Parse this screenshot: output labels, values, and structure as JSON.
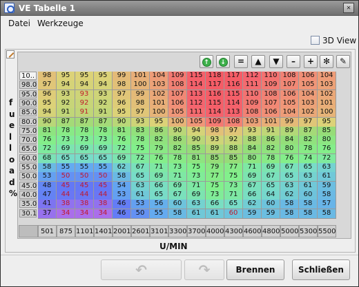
{
  "window": {
    "title": "VE Tabelle 1"
  },
  "menu": {
    "file": "Datei",
    "tools": "Werkzeuge"
  },
  "view_toggle": {
    "label": "3D View",
    "checked": false
  },
  "toolbar": {
    "eq": "=",
    "up": "▲",
    "down": "▼",
    "minus": "–",
    "plus": "+",
    "mult": "✻",
    "up_round": "↑",
    "down_round": "↓"
  },
  "y_axis_label": "fuel load %",
  "x_axis_label": "U/MIN",
  "rows": [
    "10..",
    "98.0",
    "95.0",
    "90.0",
    "85.0",
    "80.0",
    "75.0",
    "70.0",
    "65.0",
    "60.0",
    "55.0",
    "50.0",
    "45.0",
    "40.0",
    "35.0",
    "30.1"
  ],
  "cols": [
    "501",
    "875",
    "1101",
    "1401",
    "2001",
    "2601",
    "3101",
    "3300",
    "3700",
    "4000",
    "4300",
    "4600",
    "4800",
    "5000",
    "5300",
    "5500"
  ],
  "table": [
    [
      "98",
      "95",
      "95",
      "95",
      "99",
      "101",
      "104",
      "109",
      "115",
      "118",
      "117",
      "112",
      "110",
      "108",
      "106",
      "104"
    ],
    [
      "97",
      "94",
      "94",
      "94",
      "98",
      "100",
      "103",
      "108",
      "114",
      "117",
      "116",
      "111",
      "109",
      "107",
      "105",
      "103"
    ],
    [
      "96",
      "93",
      "93",
      "93",
      "97",
      "99",
      "102",
      "107",
      "113",
      "116",
      "115",
      "110",
      "108",
      "106",
      "104",
      "102"
    ],
    [
      "95",
      "92",
      "92",
      "92",
      "96",
      "98",
      "101",
      "106",
      "112",
      "115",
      "114",
      "109",
      "107",
      "105",
      "103",
      "101"
    ],
    [
      "94",
      "91",
      "91",
      "91",
      "95",
      "97",
      "100",
      "105",
      "111",
      "114",
      "113",
      "108",
      "106",
      "104",
      "102",
      "100"
    ],
    [
      "90",
      "87",
      "87",
      "87",
      "90",
      "93",
      "95",
      "100",
      "105",
      "109",
      "108",
      "103",
      "101",
      "99",
      "97",
      "95"
    ],
    [
      "81",
      "78",
      "78",
      "78",
      "81",
      "83",
      "86",
      "90",
      "94",
      "98",
      "97",
      "93",
      "91",
      "89",
      "87",
      "85"
    ],
    [
      "76",
      "73",
      "73",
      "73",
      "76",
      "78",
      "82",
      "86",
      "90",
      "93",
      "92",
      "88",
      "86",
      "84",
      "82",
      "80"
    ],
    [
      "72",
      "69",
      "69",
      "69",
      "72",
      "75",
      "79",
      "82",
      "85",
      "89",
      "88",
      "84",
      "82",
      "80",
      "78",
      "76"
    ],
    [
      "68",
      "65",
      "65",
      "65",
      "69",
      "72",
      "76",
      "78",
      "81",
      "85",
      "85",
      "80",
      "78",
      "76",
      "74",
      "72"
    ],
    [
      "58",
      "55",
      "55",
      "55",
      "62",
      "67",
      "71",
      "73",
      "75",
      "79",
      "77",
      "71",
      "69",
      "67",
      "65",
      "63"
    ],
    [
      "53",
      "50",
      "50",
      "50",
      "58",
      "65",
      "69",
      "71",
      "73",
      "77",
      "75",
      "69",
      "67",
      "65",
      "63",
      "61"
    ],
    [
      "48",
      "45",
      "45",
      "45",
      "54",
      "63",
      "66",
      "69",
      "71",
      "75",
      "73",
      "67",
      "65",
      "63",
      "61",
      "59"
    ],
    [
      "47",
      "44",
      "44",
      "44",
      "53",
      "61",
      "65",
      "67",
      "69",
      "73",
      "71",
      "66",
      "64",
      "62",
      "60",
      "58"
    ],
    [
      "41",
      "38",
      "38",
      "38",
      "46",
      "53",
      "56",
      "60",
      "63",
      "66",
      "65",
      "62",
      "60",
      "58",
      "58",
      "57"
    ],
    [
      "37",
      "34",
      "34",
      "34",
      "46",
      "50",
      "55",
      "58",
      "61",
      "61",
      "60",
      "59",
      "59",
      "58",
      "58",
      "58"
    ]
  ]
}
